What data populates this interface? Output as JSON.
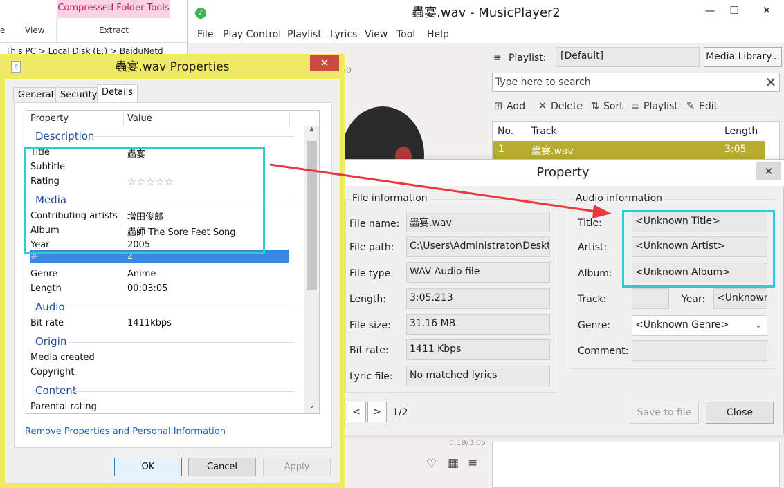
{
  "explorer": {
    "ribbon_context": "Compressed Folder Tools",
    "tab_e": "e",
    "tab_view": "View",
    "tab_extract": "Extract",
    "address": "This PC  >  Local Disk (E:)  >  BaiduNetd"
  },
  "player": {
    "title": "蟲宴.wav - MusicPlayer2",
    "menu": [
      "File",
      "Play Control",
      "Playlist",
      "Lyrics",
      "View",
      "Tool",
      "Help"
    ],
    "stereo_text": "ereo",
    "time": "0:19/3:05",
    "playlist_label": "Playlist:",
    "playlist_value": "[Default]",
    "media_library": "Media Library...",
    "search_placeholder": "Type here to search",
    "toolbar": {
      "add": "Add",
      "delete": "Delete",
      "sort": "Sort",
      "playlist": "Playlist",
      "edit": "Edit"
    },
    "list_headers": {
      "no": "No.",
      "track": "Track",
      "length": "Length"
    },
    "list_rows": [
      {
        "no": "1",
        "track": "蟲宴.wav",
        "length": "3:05"
      }
    ]
  },
  "property_dialog": {
    "title": "Property",
    "file_info_title": "File information",
    "audio_info_title": "Audio information",
    "file_info": [
      {
        "label": "File name:",
        "value": "蟲宴.wav"
      },
      {
        "label": "File path:",
        "value": "C:\\Users\\Administrator\\Deskto"
      },
      {
        "label": "File type:",
        "value": "WAV Audio file"
      },
      {
        "label": "Length:",
        "value": "3:05.213"
      },
      {
        "label": "File size:",
        "value": "31.16 MB"
      },
      {
        "label": "Bit rate:",
        "value": "1411 Kbps"
      },
      {
        "label": "Lyric file:",
        "value": "No matched lyrics"
      }
    ],
    "audio_info": {
      "title_label": "Title:",
      "title_value": "<Unknown Title>",
      "artist_label": "Artist:",
      "artist_value": "<Unknown Artist>",
      "album_label": "Album:",
      "album_value": "<Unknown Album>",
      "track_label": "Track:",
      "track_value": "",
      "year_label": "Year:",
      "year_value": "<Unknown",
      "genre_label": "Genre:",
      "genre_value": "<Unknown Genre>",
      "comment_label": "Comment:",
      "comment_value": ""
    },
    "prev": "<",
    "next": ">",
    "page": "1/2",
    "save_to_file": "Save to file",
    "close": "Close"
  },
  "win_properties": {
    "title": "蟲宴.wav Properties",
    "tabs": [
      "General",
      "Security",
      "Details"
    ],
    "col_property": "Property",
    "col_value": "Value",
    "sections": {
      "description": "Description",
      "media": "Media",
      "audio": "Audio",
      "origin": "Origin",
      "content": "Content"
    },
    "rows": {
      "title_k": "Title",
      "title_v": "蟲宴",
      "subtitle_k": "Subtitle",
      "subtitle_v": "",
      "rating_k": "Rating",
      "rating_stars": "☆☆☆☆☆",
      "artists_k": "Contributing artists",
      "artists_v": "增田俊郎",
      "album_k": "Album",
      "album_v": "蟲師 The Sore Feet Song",
      "year_k": "Year",
      "year_v": "2005",
      "num_k": "#",
      "num_v": "2",
      "genre_k": "Genre",
      "genre_v": "Anime",
      "length_k": "Length",
      "length_v": "00:03:05",
      "bitrate_k": "Bit rate",
      "bitrate_v": "1411kbps",
      "media_created_k": "Media created",
      "copyright_k": "Copyright",
      "parental_k": "Parental rating"
    },
    "remove_link": "Remove Properties and Personal Information",
    "ok": "OK",
    "cancel": "Cancel",
    "apply": "Apply"
  },
  "colors": {
    "highlight_box": "#2ecbd1",
    "arrow": "#e8383d",
    "dialog_frame": "#f0e963",
    "playlist_selected": "#b8ad2e",
    "selected_row": "#3b88e0"
  }
}
